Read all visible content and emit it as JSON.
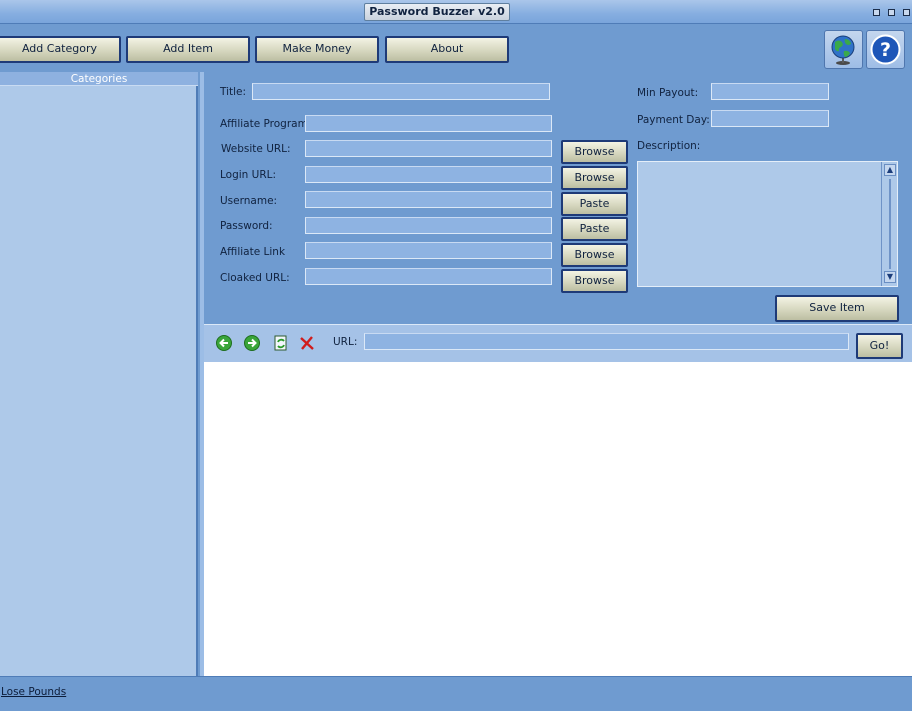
{
  "window": {
    "title": "Password Buzzer v2.0"
  },
  "toolbar": {
    "add_category": "Add Category",
    "add_item": "Add Item",
    "make_money": "Make Money",
    "about": "About"
  },
  "sidebar": {
    "header": "Categories"
  },
  "form": {
    "title_label": "Title:",
    "affiliate_program_label": "Affiliate Program:",
    "website_url_label": "Website URL:",
    "login_url_label": "Login URL:",
    "username_label": "Username:",
    "password_label": "Password:",
    "affiliate_link_label": "Affiliate Link",
    "cloaked_url_label": "Cloaked URL:",
    "min_payout_label": "Min Payout:",
    "payment_day_label": "Payment Day:",
    "description_label": "Description:",
    "browse_label": "Browse",
    "paste_label": "Paste",
    "save_item": "Save Item"
  },
  "browser": {
    "url_label": "URL:",
    "go_label": "Go!"
  },
  "status": {
    "link": "Lose Pounds"
  },
  "icons": {
    "back": "back-arrow-icon",
    "forward": "forward-arrow-icon",
    "refresh": "refresh-icon",
    "stop": "stop-icon",
    "globe": "globe-icon",
    "help": "help-icon"
  },
  "colors": {
    "window_bg": "#6f9bd0",
    "panel_bg": "#aec9e9",
    "button_border": "#1e3a77",
    "field_bg": "#8eb3e2"
  }
}
